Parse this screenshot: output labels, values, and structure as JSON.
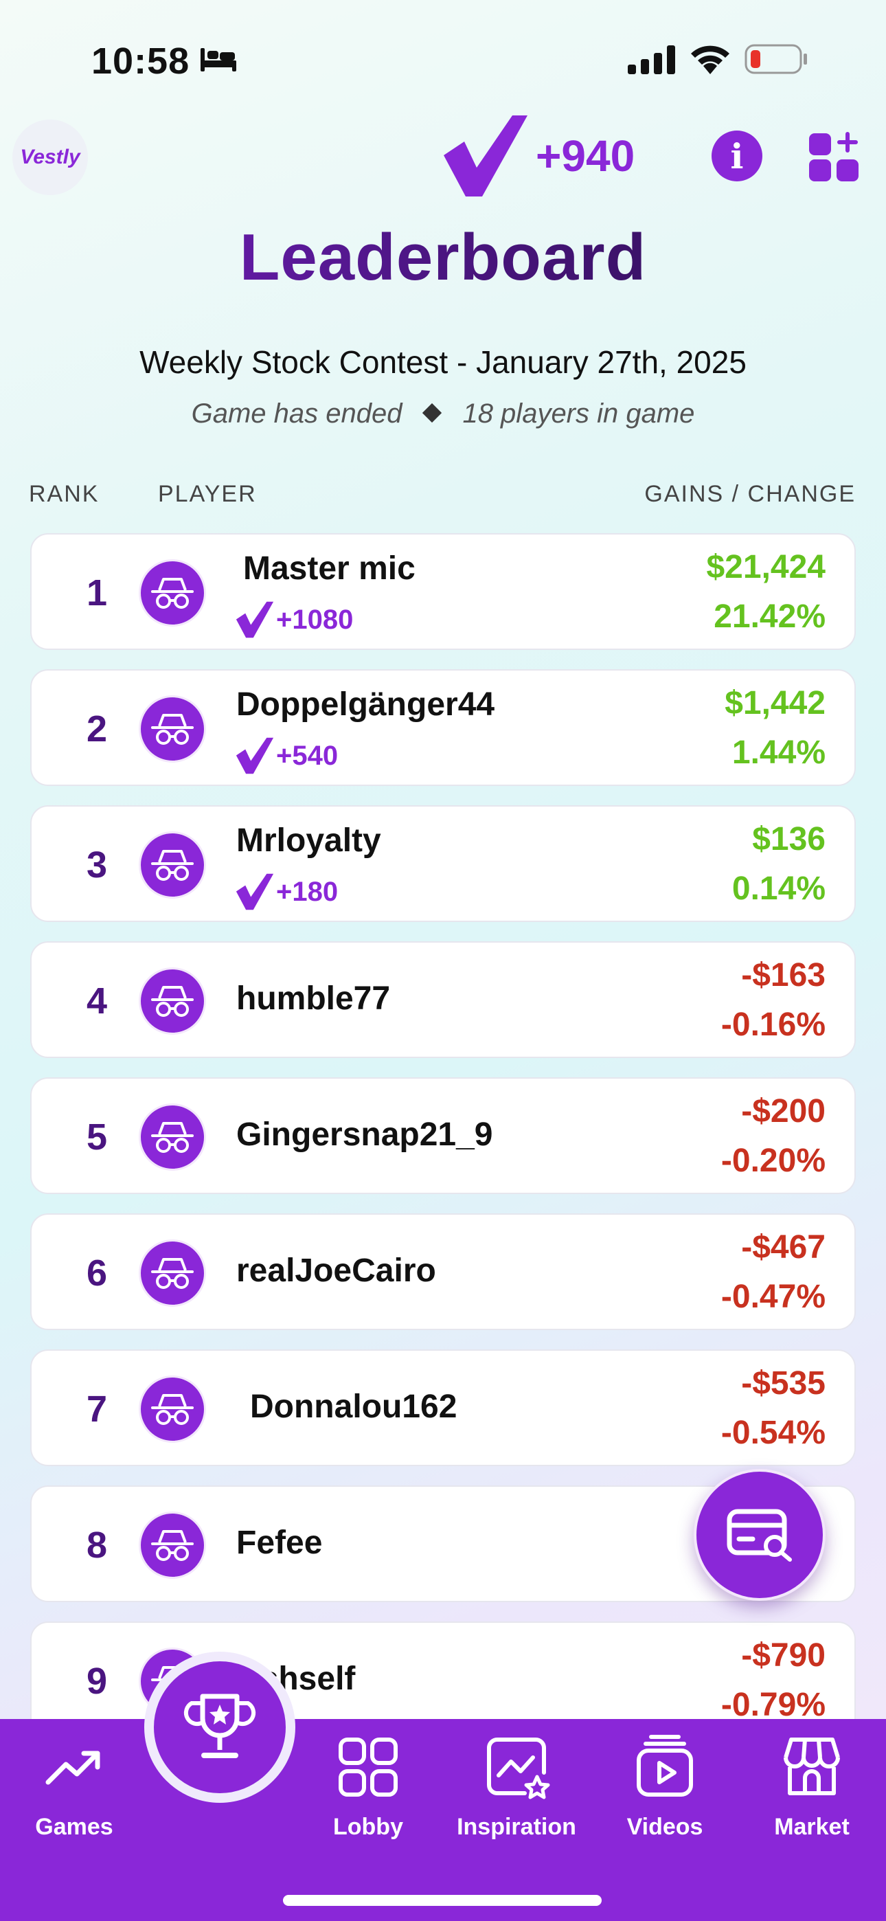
{
  "status_bar": {
    "time": "10:58"
  },
  "header": {
    "logo_text": "Vestly",
    "points": "+940",
    "info_label": "i"
  },
  "title": "Leaderboard",
  "contest": {
    "name": "Weekly Stock Contest - January 27th, 2025",
    "status": "Game has ended",
    "players": "18 players in game"
  },
  "columns": {
    "rank": "RANK",
    "player": "PLAYER",
    "gains": "GAINS / CHANGE"
  },
  "rows": [
    {
      "rank": "1",
      "name": "Master mic",
      "points": "+1080",
      "gain": "$21,424",
      "pct": "21.42%",
      "positive": true
    },
    {
      "rank": "2",
      "name": "Doppelgänger44",
      "points": "+540",
      "gain": "$1,442",
      "pct": "1.44%",
      "positive": true
    },
    {
      "rank": "3",
      "name": "Mrloyalty",
      "points": "+180",
      "gain": "$136",
      "pct": "0.14%",
      "positive": true
    },
    {
      "rank": "4",
      "name": "humble77",
      "points": "",
      "gain": "-$163",
      "pct": "-0.16%",
      "positive": false
    },
    {
      "rank": "5",
      "name": "Gingersnap21_9",
      "points": "",
      "gain": "-$200",
      "pct": "-0.20%",
      "positive": false
    },
    {
      "rank": "6",
      "name": "realJoeCairo",
      "points": "",
      "gain": "-$467",
      "pct": "-0.47%",
      "positive": false
    },
    {
      "rank": "7",
      "name": "Donnalou162",
      "points": "",
      "gain": "-$535",
      "pct": "-0.54%",
      "positive": false
    },
    {
      "rank": "8",
      "name": "Fefee",
      "points": "",
      "gain": "",
      "pct": "",
      "positive": false
    },
    {
      "rank": "9",
      "name": "Ashself",
      "points": "",
      "gain": "-$790",
      "pct": "-0.79%",
      "positive": false
    }
  ],
  "nav": {
    "games": "Games",
    "lobby": "Lobby",
    "inspiration": "Inspiration",
    "videos": "Videos",
    "market": "Market"
  },
  "colors": {
    "brand": "#8a27d8",
    "positive": "#64c21f",
    "negative": "#c8311f"
  }
}
